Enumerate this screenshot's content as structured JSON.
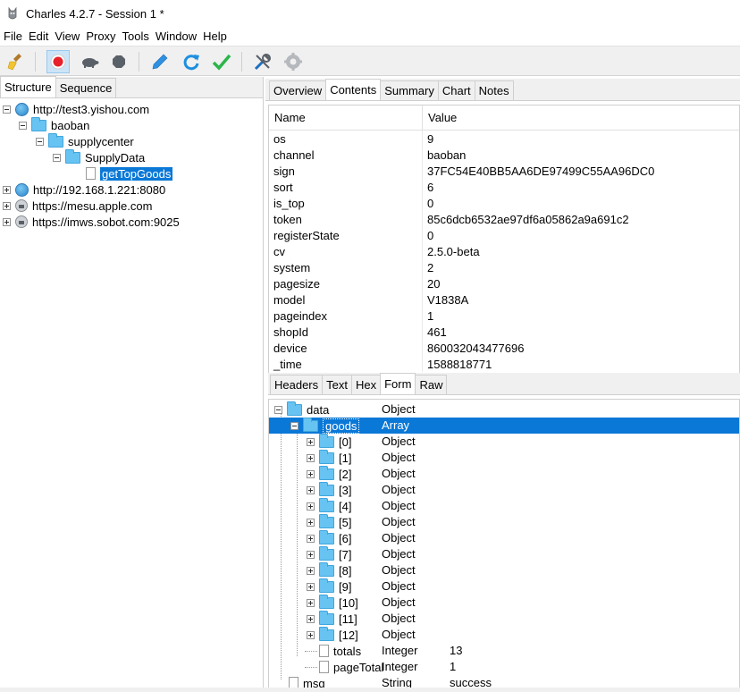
{
  "window": {
    "title": "Charles 4.2.7 - Session 1 *"
  },
  "menu": [
    "File",
    "Edit",
    "View",
    "Proxy",
    "Tools",
    "Window",
    "Help"
  ],
  "toolbar": {
    "icons": [
      "broom-icon",
      "record-icon",
      "turtle-icon",
      "hexagon-stop-icon",
      "pen-icon",
      "refresh-icon",
      "check-icon",
      "tools-icon",
      "settings-gear-icon"
    ]
  },
  "left_tabs": [
    "Structure",
    "Sequence"
  ],
  "tree": [
    {
      "label": "http://test3.yishou.com",
      "kind": "globe",
      "expander": "minus",
      "level": 0
    },
    {
      "label": "baoban",
      "kind": "folder",
      "expander": "minus",
      "level": 1
    },
    {
      "label": "supplycenter",
      "kind": "folder",
      "expander": "minus",
      "level": 2
    },
    {
      "label": "SupplyData",
      "kind": "folder",
      "expander": "minus",
      "level": 3
    },
    {
      "label": "getTopGoods",
      "kind": "file",
      "expander": "none",
      "level": 4,
      "selected": true
    },
    {
      "label": "http://192.168.1.221:8080",
      "kind": "globe",
      "expander": "plus",
      "level": 0
    },
    {
      "label": "https://mesu.apple.com",
      "kind": "lock",
      "expander": "plus",
      "level": 0
    },
    {
      "label": "https://imws.sobot.com:9025",
      "kind": "lock",
      "expander": "plus",
      "level": 0
    }
  ],
  "right_tabs": [
    "Overview",
    "Contents",
    "Summary",
    "Chart",
    "Notes"
  ],
  "right_tabs_selected": "Contents",
  "params_table": {
    "headers": {
      "name": "Name",
      "value": "Value"
    },
    "rows": [
      {
        "name": "os",
        "value": "9"
      },
      {
        "name": "channel",
        "value": "baoban"
      },
      {
        "name": "sign",
        "value": "37FC54E40BB5AA6DE97499C55AA96DC0"
      },
      {
        "name": "sort",
        "value": "6"
      },
      {
        "name": "is_top",
        "value": "0"
      },
      {
        "name": "token",
        "value": "85c6dcb6532ae97df6a05862a9a691c2"
      },
      {
        "name": "registerState",
        "value": "0"
      },
      {
        "name": "cv",
        "value": "2.5.0-beta"
      },
      {
        "name": "system",
        "value": "2"
      },
      {
        "name": "pagesize",
        "value": "20"
      },
      {
        "name": "model",
        "value": "V1838A"
      },
      {
        "name": "pageindex",
        "value": "1"
      },
      {
        "name": "shopId",
        "value": "461"
      },
      {
        "name": "device",
        "value": "860032043477696"
      },
      {
        "name": "_time",
        "value": "1588818771"
      }
    ]
  },
  "bottom_tabs": [
    "Headers",
    "Text",
    "Hex",
    "Form",
    "Raw"
  ],
  "bottom_tabs_selected": "Form",
  "form_tree": {
    "data": {
      "name": "data",
      "type": "Object",
      "value": ""
    },
    "goods": {
      "name": "goods",
      "type": "Array",
      "value": ""
    },
    "items": [
      {
        "name": "[0]",
        "type": "Object"
      },
      {
        "name": "[1]",
        "type": "Object"
      },
      {
        "name": "[2]",
        "type": "Object"
      },
      {
        "name": "[3]",
        "type": "Object"
      },
      {
        "name": "[4]",
        "type": "Object"
      },
      {
        "name": "[5]",
        "type": "Object"
      },
      {
        "name": "[6]",
        "type": "Object"
      },
      {
        "name": "[7]",
        "type": "Object"
      },
      {
        "name": "[8]",
        "type": "Object"
      },
      {
        "name": "[9]",
        "type": "Object"
      },
      {
        "name": "[10]",
        "type": "Object"
      },
      {
        "name": "[11]",
        "type": "Object"
      },
      {
        "name": "[12]",
        "type": "Object"
      }
    ],
    "totals": {
      "name": "totals",
      "type": "Integer",
      "value": "13"
    },
    "pageTotal": {
      "name": "pageTotal",
      "type": "Integer",
      "value": "1"
    },
    "msg": {
      "name": "msg",
      "type": "String",
      "value": "success"
    }
  }
}
